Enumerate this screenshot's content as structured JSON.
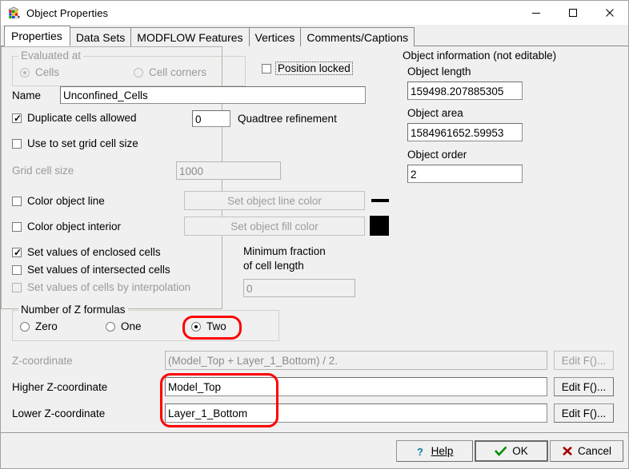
{
  "window": {
    "title": "Object Properties",
    "icon": "cube-icon",
    "controls": {
      "minimize": "minimize-icon",
      "maximize": "maximize-icon",
      "close": "close-icon"
    }
  },
  "tabs": [
    {
      "label": "Properties",
      "active": true
    },
    {
      "label": "Data Sets",
      "active": false
    },
    {
      "label": "MODFLOW Features",
      "active": false
    },
    {
      "label": "Vertices",
      "active": false
    },
    {
      "label": "Comments/Captions",
      "active": false
    }
  ],
  "evaluated_at": {
    "caption": "Evaluated at",
    "options": [
      {
        "label": "Cells",
        "selected": true,
        "disabled": true
      },
      {
        "label": "Cell corners",
        "selected": false,
        "disabled": true
      }
    ]
  },
  "position_locked": {
    "label": "Position locked",
    "checked": false
  },
  "name_field": {
    "label": "Name",
    "value": "Unconfined_Cells"
  },
  "duplicate_cells": {
    "label": "Duplicate cells allowed",
    "checked": true
  },
  "quadtree": {
    "label": "Quadtree refinement",
    "value": "0"
  },
  "use_grid_cell_size": {
    "label": "Use to set grid cell size",
    "checked": false
  },
  "grid_cell_size": {
    "label": "Grid cell size",
    "value": "1000",
    "disabled": true
  },
  "color_object_line": {
    "label": "Color object line",
    "checked": false,
    "button": "Set object line color",
    "swatch": "#000000"
  },
  "color_object_interior": {
    "label": "Color object interior",
    "checked": false,
    "button": "Set object fill color",
    "swatch": "#000000"
  },
  "set_values": [
    {
      "label": "Set values of enclosed cells",
      "checked": true,
      "disabled": false
    },
    {
      "label": "Set values of intersected cells",
      "checked": false,
      "disabled": false
    },
    {
      "label": "Set values of cells by interpolation",
      "checked": false,
      "disabled": true
    }
  ],
  "minimum_fraction": {
    "label_line1": "Minimum fraction",
    "label_line2": "of cell length",
    "value": "0",
    "disabled": true
  },
  "object_information": {
    "caption": "Object information (not editable)",
    "fields": [
      {
        "label": "Object length",
        "value": "159498.207885305"
      },
      {
        "label": "Object area",
        "value": "1584961652.59953"
      },
      {
        "label": "Object order",
        "value": "2"
      }
    ]
  },
  "z_formulas": {
    "caption": "Number of Z formulas",
    "options": [
      {
        "label": "Zero",
        "selected": false
      },
      {
        "label": "One",
        "selected": false
      },
      {
        "label": "Two",
        "selected": true
      }
    ]
  },
  "z_rows": [
    {
      "label": "Z-coordinate",
      "value": "(Model_Top + Layer_1_Bottom) / 2.",
      "disabled": true,
      "button": "Edit F()...",
      "button_disabled": true
    },
    {
      "label": "Higher Z-coordinate",
      "value": "Model_Top",
      "disabled": false,
      "button": "Edit F()...",
      "button_disabled": false
    },
    {
      "label": "Lower Z-coordinate",
      "value": "Layer_1_Bottom",
      "disabled": false,
      "button": "Edit F()...",
      "button_disabled": false
    }
  ],
  "footer": {
    "help": "Help",
    "ok": "OK",
    "cancel": "Cancel",
    "help_icon": "question-mark-icon",
    "ok_icon": "check-mark-icon",
    "cancel_icon": "x-mark-icon"
  },
  "annotations": {
    "colors": {
      "highlight": "#ff0000"
    },
    "items": [
      {
        "target": "radio-two"
      },
      {
        "target": "z-coordinate-fields"
      }
    ]
  }
}
